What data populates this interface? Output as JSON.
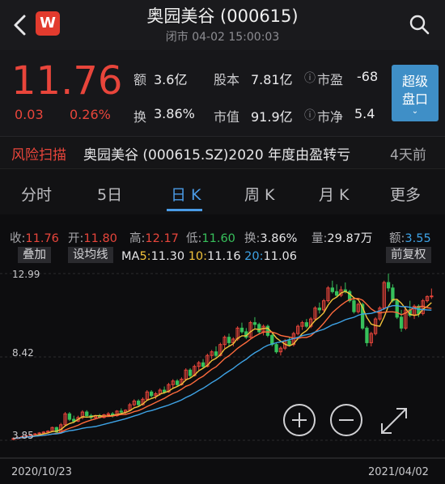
{
  "header": {
    "title": "奥园美谷 (000615)",
    "subtitle": "闭市 04-02 15:00:03",
    "logo_letter": "W"
  },
  "quote": {
    "price": "11.76",
    "change": "0.03",
    "change_pct": "0.26%",
    "fields": [
      {
        "label": "额",
        "value": "3.6亿"
      },
      {
        "label": "股本",
        "value": "7.81亿"
      },
      {
        "label": "市盈",
        "value": "-68"
      },
      {
        "label": "换",
        "value": "3.86%"
      },
      {
        "label": "市值",
        "value": "91.9亿"
      },
      {
        "label": "市净",
        "value": "5.4"
      }
    ],
    "super_button": [
      "超级",
      "盘口"
    ]
  },
  "news": {
    "tag": "风险扫描",
    "text": "奥园美谷 (000615.SZ)2020 年度由盈转亏",
    "time": "4天前"
  },
  "tabs": [
    "分时",
    "5日",
    "日 K",
    "周 K",
    "月 K",
    "更多"
  ],
  "active_tab": "日 K",
  "stats": {
    "close_label": "收:",
    "close": "11.76",
    "open_label": "开:",
    "open": "11.80",
    "high_label": "高:",
    "high": "12.17",
    "low_label": "低:",
    "low": "11.60",
    "turnover_label": "换:",
    "turnover": "3.86%",
    "volume_label": "量:",
    "volume": "29.87万",
    "amount_label": "额:",
    "amount": "3.55"
  },
  "chart_toolbar": {
    "overlay": "叠加",
    "set_ma": "设均线",
    "ma_prefix": "MA",
    "ma5_label": "5:",
    "ma5": "11.30",
    "ma10_label": "10:",
    "ma10": "11.16",
    "ma20_label": "20:",
    "ma20": "11.06",
    "adjust": "前复权"
  },
  "colors": {
    "up": "#e8453b",
    "down": "#37c05b",
    "ma5": "#f2c33b",
    "ma10": "#ff6b3d",
    "ma20": "#3ea3e6"
  },
  "chart_data": {
    "type": "candlestick",
    "ylim": [
      3.85,
      12.99
    ],
    "y_ticks": [
      "12.99",
      "8.42",
      "3.85"
    ],
    "x_ticks": [
      "2020/10/23",
      "2021/04/02"
    ],
    "ohlc": [
      [
        3.9,
        4.0,
        3.85,
        3.95
      ],
      [
        3.95,
        4.05,
        3.9,
        4.0
      ],
      [
        4.0,
        4.1,
        3.95,
        4.05
      ],
      [
        4.05,
        4.15,
        4.0,
        4.1
      ],
      [
        4.1,
        4.2,
        4.05,
        4.15
      ],
      [
        4.15,
        4.25,
        4.1,
        4.2
      ],
      [
        4.2,
        4.3,
        4.1,
        4.25
      ],
      [
        4.25,
        4.35,
        4.2,
        4.3
      ],
      [
        4.3,
        4.4,
        4.25,
        4.35
      ],
      [
        4.35,
        4.6,
        4.3,
        4.55
      ],
      [
        4.55,
        4.6,
        4.2,
        4.3
      ],
      [
        4.3,
        4.8,
        4.25,
        4.7
      ],
      [
        4.7,
        5.4,
        4.65,
        5.3
      ],
      [
        5.3,
        5.4,
        4.9,
        5.0
      ],
      [
        5.0,
        5.2,
        4.8,
        4.9
      ],
      [
        4.9,
        5.2,
        4.85,
        5.1
      ],
      [
        5.1,
        5.5,
        5.0,
        5.4
      ],
      [
        5.4,
        5.5,
        5.1,
        5.2
      ],
      [
        5.2,
        5.3,
        5.0,
        5.1
      ],
      [
        5.1,
        5.25,
        5.0,
        5.2
      ],
      [
        5.2,
        5.3,
        5.05,
        5.1
      ],
      [
        5.1,
        5.3,
        5.05,
        5.25
      ],
      [
        5.25,
        5.4,
        5.15,
        5.3
      ],
      [
        5.3,
        5.4,
        5.1,
        5.2
      ],
      [
        5.2,
        5.5,
        5.15,
        5.45
      ],
      [
        5.45,
        5.6,
        5.3,
        5.4
      ],
      [
        5.4,
        5.55,
        5.3,
        5.5
      ],
      [
        5.5,
        5.9,
        5.45,
        5.8
      ],
      [
        5.8,
        6.1,
        5.7,
        6.0
      ],
      [
        6.0,
        6.1,
        5.7,
        5.8
      ],
      [
        5.8,
        6.2,
        5.75,
        6.1
      ],
      [
        6.1,
        6.6,
        6.05,
        6.5
      ],
      [
        6.5,
        6.6,
        6.2,
        6.3
      ],
      [
        6.3,
        6.5,
        6.1,
        6.4
      ],
      [
        6.4,
        6.7,
        6.3,
        6.6
      ],
      [
        6.6,
        6.8,
        6.4,
        6.5
      ],
      [
        6.5,
        7.0,
        6.45,
        6.9
      ],
      [
        6.9,
        7.2,
        6.7,
        7.1
      ],
      [
        7.1,
        7.2,
        6.8,
        6.9
      ],
      [
        6.9,
        7.3,
        6.85,
        7.2
      ],
      [
        7.2,
        7.8,
        7.1,
        7.7
      ],
      [
        7.7,
        7.8,
        7.3,
        7.4
      ],
      [
        7.4,
        8.0,
        7.35,
        7.9
      ],
      [
        7.9,
        8.2,
        7.7,
        8.1
      ],
      [
        8.1,
        8.3,
        7.8,
        7.9
      ],
      [
        7.9,
        8.6,
        7.85,
        8.5
      ],
      [
        8.5,
        8.8,
        8.3,
        8.7
      ],
      [
        8.7,
        9.0,
        8.4,
        8.5
      ],
      [
        8.5,
        9.2,
        8.45,
        9.1
      ],
      [
        9.1,
        9.6,
        8.9,
        9.5
      ],
      [
        9.5,
        9.7,
        9.0,
        9.2
      ],
      [
        9.2,
        9.5,
        9.0,
        9.4
      ],
      [
        9.4,
        10.1,
        9.3,
        10.0
      ],
      [
        10.0,
        10.3,
        9.7,
        9.8
      ],
      [
        9.8,
        10.0,
        9.4,
        9.5
      ],
      [
        9.5,
        10.4,
        9.45,
        10.3
      ],
      [
        10.3,
        10.6,
        10.0,
        10.2
      ],
      [
        10.2,
        10.3,
        9.7,
        9.8
      ],
      [
        9.8,
        10.2,
        9.6,
        10.1
      ],
      [
        10.1,
        10.2,
        9.5,
        9.6
      ],
      [
        9.6,
        9.7,
        9.0,
        9.1
      ],
      [
        9.1,
        9.2,
        8.6,
        8.7
      ],
      [
        8.7,
        9.0,
        8.5,
        8.9
      ],
      [
        8.9,
        9.4,
        8.8,
        9.3
      ],
      [
        9.3,
        9.5,
        9.0,
        9.1
      ],
      [
        9.1,
        9.8,
        9.0,
        9.7
      ],
      [
        9.7,
        10.2,
        9.6,
        10.1
      ],
      [
        10.1,
        10.4,
        9.9,
        10.3
      ],
      [
        10.3,
        10.5,
        10.0,
        10.1
      ],
      [
        10.1,
        10.6,
        10.0,
        10.5
      ],
      [
        10.5,
        11.2,
        10.4,
        11.1
      ],
      [
        11.1,
        11.4,
        10.8,
        11.0
      ],
      [
        11.0,
        11.6,
        10.9,
        11.5
      ],
      [
        11.5,
        12.3,
        11.4,
        12.2
      ],
      [
        12.2,
        12.6,
        11.9,
        12.0
      ],
      [
        12.0,
        12.4,
        11.7,
        11.8
      ],
      [
        11.8,
        12.3,
        11.7,
        12.1
      ],
      [
        12.1,
        12.5,
        11.9,
        12.0
      ],
      [
        12.0,
        12.1,
        11.4,
        11.5
      ],
      [
        11.5,
        11.6,
        10.8,
        10.9
      ],
      [
        10.9,
        11.4,
        10.8,
        11.3
      ],
      [
        11.3,
        11.4,
        9.9,
        10.0
      ],
      [
        10.0,
        10.1,
        9.0,
        9.2
      ],
      [
        9.2,
        9.8,
        9.0,
        9.7
      ],
      [
        9.7,
        10.6,
        9.6,
        10.5
      ],
      [
        10.5,
        11.2,
        10.4,
        11.1
      ],
      [
        11.1,
        12.6,
        11.0,
        12.5
      ],
      [
        12.5,
        12.99,
        12.0,
        12.2
      ],
      [
        12.2,
        12.4,
        11.4,
        11.5
      ],
      [
        11.5,
        11.6,
        10.5,
        10.6
      ],
      [
        10.6,
        11.0,
        9.8,
        10.0
      ],
      [
        10.0,
        11.2,
        9.9,
        11.0
      ],
      [
        11.0,
        11.5,
        10.6,
        10.7
      ],
      [
        10.7,
        11.3,
        10.5,
        11.2
      ],
      [
        11.2,
        11.3,
        10.6,
        10.8
      ],
      [
        10.8,
        11.6,
        10.7,
        11.5
      ],
      [
        11.5,
        11.8,
        11.4,
        11.73
      ],
      [
        11.73,
        12.17,
        11.6,
        11.76
      ]
    ]
  }
}
